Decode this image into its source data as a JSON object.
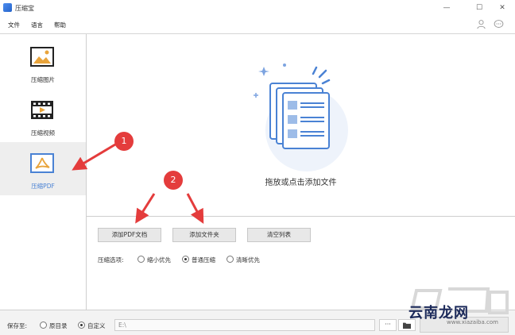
{
  "window": {
    "title": "压缩宝"
  },
  "menu": {
    "items": [
      "文件",
      "语言",
      "帮助"
    ]
  },
  "sidebar": {
    "items": [
      {
        "label": "压缩图片",
        "icon": "image-icon"
      },
      {
        "label": "压缩视频",
        "icon": "video-icon"
      },
      {
        "label": "压缩PDF",
        "icon": "pdf-icon",
        "active": true
      }
    ]
  },
  "drop_area": {
    "text": "拖放或点击添加文件"
  },
  "buttons": {
    "add_pdf": "添加PDF文档",
    "add_folder": "添加文件夹",
    "clear_list": "清空列表"
  },
  "compress_options": {
    "label": "压缩选项:",
    "options": [
      {
        "label": "缩小优先",
        "checked": false
      },
      {
        "label": "普通压缩",
        "checked": true
      },
      {
        "label": "清晰优先",
        "checked": false
      }
    ]
  },
  "save": {
    "label": "保存至:",
    "options": [
      {
        "label": "原目录",
        "checked": false
      },
      {
        "label": "自定义",
        "checked": true
      }
    ],
    "path": "E:\\",
    "browse_label": "···"
  },
  "annotations": [
    "1",
    "2"
  ],
  "watermark": {
    "main": "云南龙网",
    "sub": "www.xiazaiba.com"
  },
  "colors": {
    "accent": "#4a82d4",
    "annotation": "#e43c3c",
    "active_bg": "#eeeeee"
  }
}
